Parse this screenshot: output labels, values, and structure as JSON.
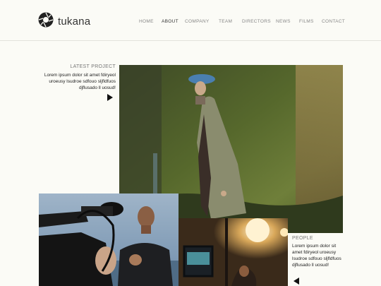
{
  "brand": {
    "name": "tukana",
    "logo_icon": "aperture-icon"
  },
  "nav": {
    "items": [
      {
        "label": "HOME",
        "active": false
      },
      {
        "label": "ABOUT",
        "active": true
      },
      {
        "label": "COMPANY",
        "active": false
      },
      {
        "label": "TEAM",
        "active": false
      },
      {
        "label": "DIRECTORS",
        "active": false
      },
      {
        "label": "NEWS",
        "active": false
      },
      {
        "label": "FILMS",
        "active": false
      },
      {
        "label": "CONTACT",
        "active": false
      }
    ]
  },
  "latest_project": {
    "label": "LATEST PROJECT",
    "text": "Lorem ipsum dolor sit amet fdiryeol uroeusy lsudroe sdfouo sljfldfuos djflusado ll uosud!",
    "arrow_icon": "arrow-right-icon"
  },
  "people": {
    "label": "PEOPLE",
    "text": "Lorem ipsum dolor sit amet fdiryeol uroeusy lsudroe sdfouo sljfldfuos djflusado ll uosud!",
    "arrow_icon": "arrow-left-icon"
  },
  "colors": {
    "background": "#fbfbf6",
    "text": "#333333",
    "nav_muted": "#888888"
  }
}
